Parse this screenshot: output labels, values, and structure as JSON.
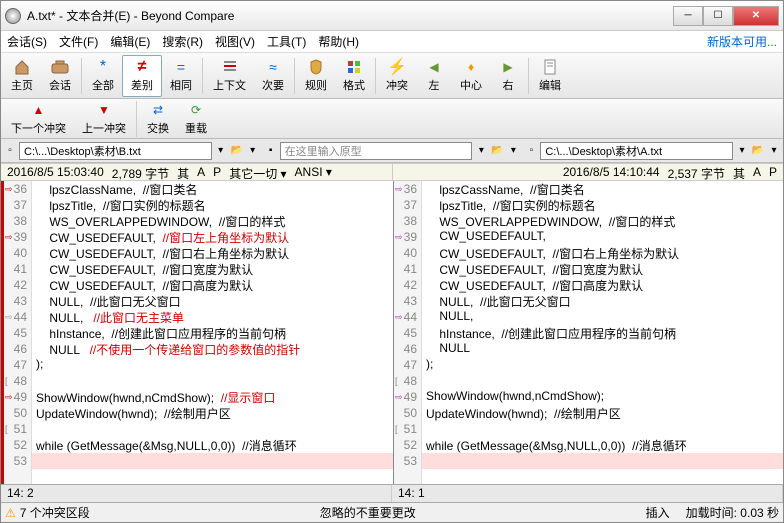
{
  "title": "A.txt* - 文本合并(E) - Beyond Compare",
  "menu": {
    "session": "会话(S)",
    "file": "文件(F)",
    "edit": "编辑(E)",
    "search": "搜索(R)",
    "view": "视图(V)",
    "tools": "工具(T)",
    "help": "帮助(H)",
    "newver": "新版本可用..."
  },
  "tb": {
    "home": "主页",
    "session": "会话",
    "all": "全部",
    "diff": "差别",
    "same": "相同",
    "context": "上下文",
    "next": "次要",
    "rules": "规则",
    "format": "格式",
    "conflict": "冲突",
    "left": "左",
    "center": "中心",
    "right": "右",
    "editbtn": "编辑"
  },
  "tb2": {
    "prevconf": "下一个冲突",
    "nextconf": "上一冲突",
    "swap": "交换",
    "reload": "重载"
  },
  "paths": {
    "left": "C:\\...\\Desktop\\素材\\B.txt",
    "centerPh": "在这里输入原型",
    "right": "C:\\...\\Desktop\\素材\\A.txt"
  },
  "info": {
    "left": {
      "date": "2016/8/5 15:03:40",
      "size": "2,789 字节",
      "a": "其",
      "b": "A",
      "c": "P",
      "d": "其它一切 ▾",
      "enc": "ANSI ▾"
    },
    "right": {
      "date": "2016/8/5 14:10:44",
      "size": "2,537 字节",
      "a": "其",
      "b": "A",
      "c": "P"
    }
  },
  "left_lines": [
    {
      "n": "36",
      "a": "red",
      "t": "    lpszClassName,  //窗口类名"
    },
    {
      "n": "37",
      "t": "    lpszTitle,  //窗口实例的标题名"
    },
    {
      "n": "38",
      "t": "    WS_OVERLAPPEDWINDOW,  //窗口的样式"
    },
    {
      "n": "39",
      "a": "red",
      "t": "    CW_USEDEFAULT,  ",
      "c": "//窗口左上角坐标为默认"
    },
    {
      "n": "40",
      "t": "    CW_USEDEFAULT,  //窗口右上角坐标为默认"
    },
    {
      "n": "41",
      "t": "    CW_USEDEFAULT,  //窗口宽度为默认"
    },
    {
      "n": "42",
      "t": "    CW_USEDEFAULT,  //窗口高度为默认"
    },
    {
      "n": "43",
      "t": "    NULL,  //此窗口无父窗口"
    },
    {
      "n": "44",
      "a": "gray",
      "t": "    NULL,   ",
      "c": "//此窗口无主菜单"
    },
    {
      "n": "45",
      "t": "    hInstance,  //创建此窗口应用程序的当前句柄"
    },
    {
      "n": "46",
      "t": "    NULL   ",
      "c": "//不使用一个传递给窗口的参数值的指针"
    },
    {
      "n": "47",
      "t": ");"
    },
    {
      "n": "48",
      "b": "[",
      "t": ""
    },
    {
      "n": "49",
      "a": "red",
      "t": "ShowWindow(hwnd,nCmdShow);  ",
      "c": "//显示窗口"
    },
    {
      "n": "50",
      "t": "UpdateWindow(hwnd);  //绘制用户区"
    },
    {
      "n": "51",
      "b": "[",
      "t": ""
    },
    {
      "n": "52",
      "t": "while (GetMessage(&Msg,NULL,0,0))  //消息循环"
    },
    {
      "n": "53",
      "t": "",
      "hl": true
    }
  ],
  "right_lines": [
    {
      "n": "36",
      "a": "purple",
      "t": "    lpszCassName,  //窗口类名"
    },
    {
      "n": "37",
      "t": "    lpszTitle,  //窗口实例的标题名"
    },
    {
      "n": "38",
      "t": "    WS_OVERLAPPEDWINDOW,  //窗口的样式"
    },
    {
      "n": "39",
      "a": "purple",
      "t": "    CW_USEDEFAULT,"
    },
    {
      "n": "40",
      "t": "    CW_USEDEFAULT,  //窗口右上角坐标为默认"
    },
    {
      "n": "41",
      "t": "    CW_USEDEFAULT,  //窗口宽度为默认"
    },
    {
      "n": "42",
      "t": "    CW_USEDEFAULT,  //窗口高度为默认"
    },
    {
      "n": "43",
      "t": "    NULL,  //此窗口无父窗口"
    },
    {
      "n": "44",
      "a": "purple",
      "t": "    NULL,"
    },
    {
      "n": "45",
      "t": "    hInstance,  //创建此窗口应用程序的当前句柄"
    },
    {
      "n": "46",
      "t": "    NULL"
    },
    {
      "n": "47",
      "t": ");"
    },
    {
      "n": "48",
      "b": "[",
      "t": ""
    },
    {
      "n": "49",
      "a": "purple",
      "t": "ShowWindow(hwnd,nCmdShow);"
    },
    {
      "n": "50",
      "t": "UpdateWindow(hwnd);  //绘制用户区"
    },
    {
      "n": "51",
      "b": "[",
      "t": ""
    },
    {
      "n": "52",
      "t": "while (GetMessage(&Msg,NULL,0,0))  //消息循环"
    },
    {
      "n": "53",
      "t": "",
      "hl": true
    }
  ],
  "pos": {
    "left": "14: 2",
    "right": "14: 1"
  },
  "status": {
    "conflicts": "7 个冲突区段",
    "ignore": "忽略的不重要更改",
    "mode": "插入",
    "load": "加载时间: 0.03 秒"
  }
}
